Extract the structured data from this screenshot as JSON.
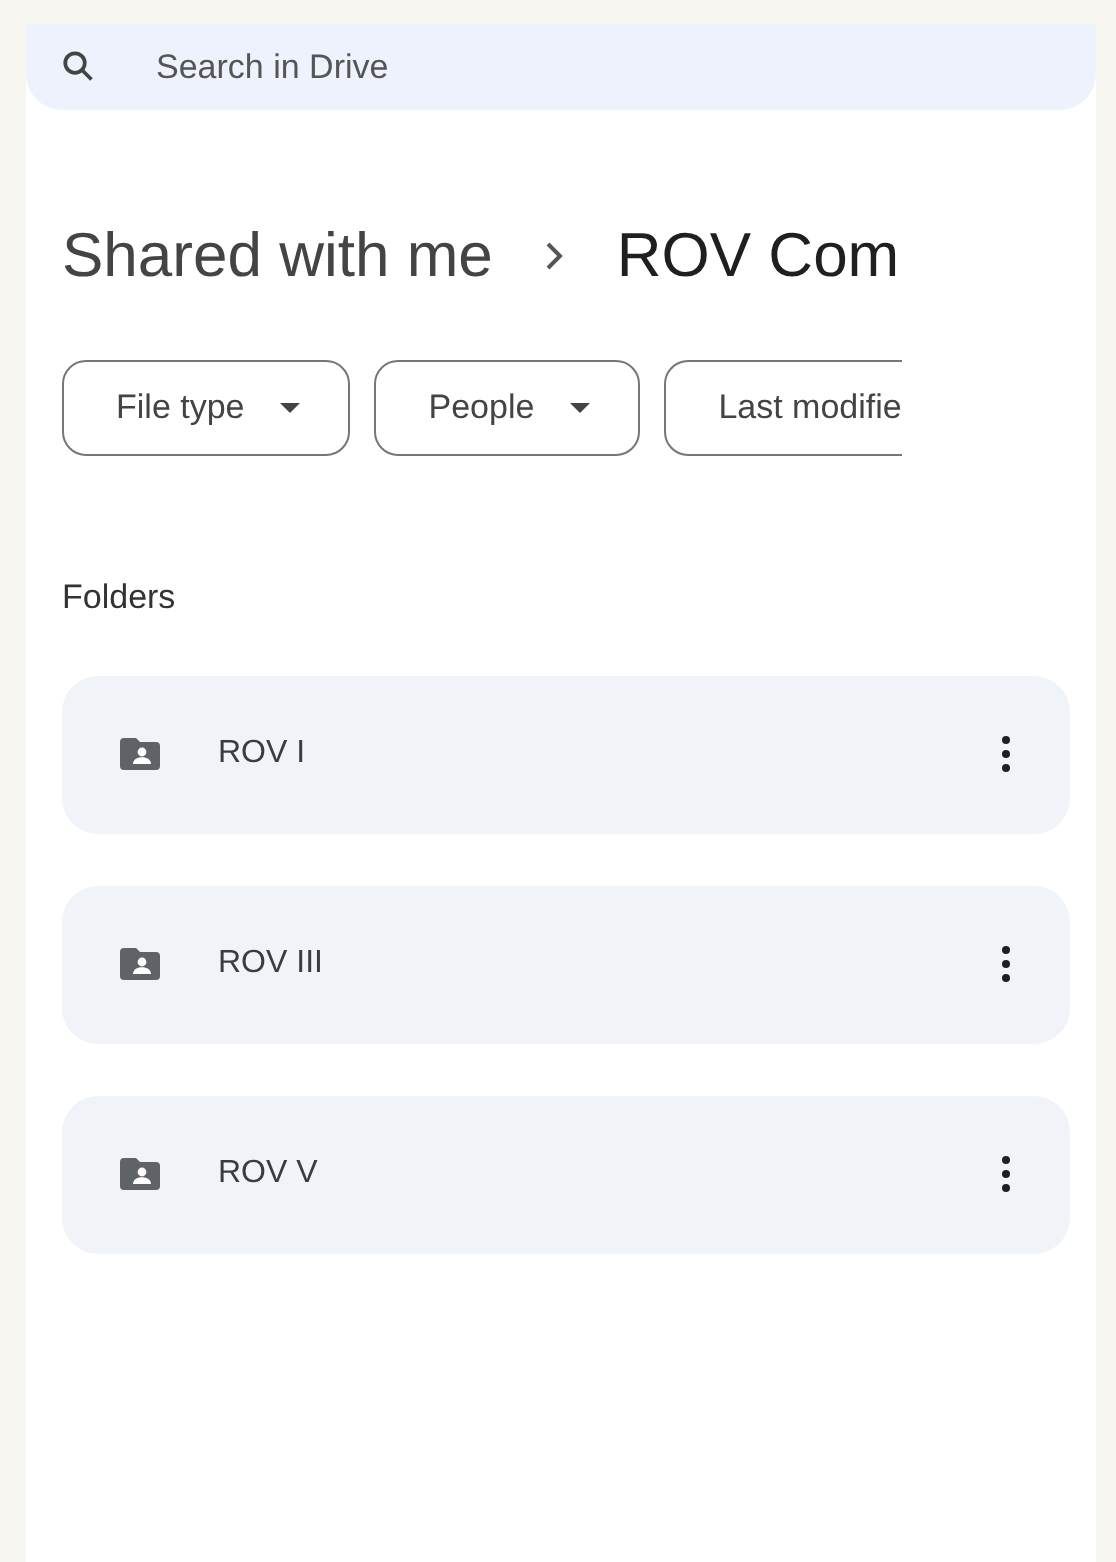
{
  "search": {
    "placeholder": "Search in Drive"
  },
  "breadcrumb": [
    {
      "label": "Shared with me"
    },
    {
      "label": "ROV Com"
    }
  ],
  "filters": [
    {
      "label": "File type"
    },
    {
      "label": "People"
    },
    {
      "label": "Last modifie"
    }
  ],
  "folders": {
    "heading": "Folders",
    "items": [
      {
        "name": "ROV I"
      },
      {
        "name": "ROV III"
      },
      {
        "name": "ROV V"
      }
    ]
  }
}
